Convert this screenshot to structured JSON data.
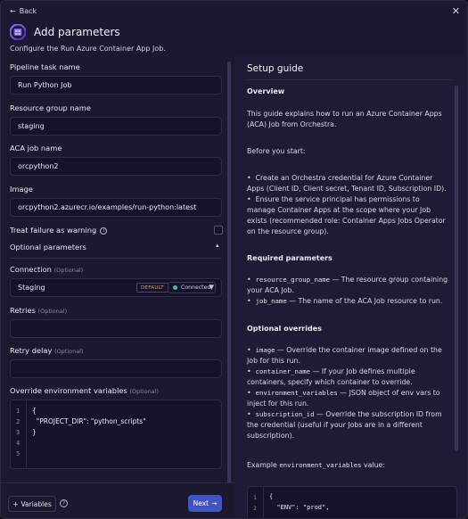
{
  "header": {
    "back_label": "Back",
    "close_glyph": "✕",
    "title": "Add parameters",
    "subtitle": "Configure the Run Azure Container App Job."
  },
  "form": {
    "pipeline_task_name": {
      "label": "Pipeline task name",
      "value": "Run Python Job"
    },
    "resource_group_name": {
      "label": "Resource group name",
      "value": "staging"
    },
    "aca_job_name": {
      "label": "ACA job name",
      "value": "orcpython2"
    },
    "image": {
      "label": "Image",
      "value": "orcpython2.azurecr.io/examples/run-python:latest"
    },
    "treat_failure": {
      "label": "Treat failure as warning",
      "checked": false
    },
    "optional_section": {
      "label": "Optional parameters",
      "expanded": true
    },
    "connection": {
      "label": "Connection",
      "optional_tag": "(Optional)",
      "value": "Staging",
      "default_badge": "DEFAULT",
      "status": "Connected"
    },
    "retries": {
      "label": "Retries",
      "optional_tag": "(Optional)",
      "value": ""
    },
    "retry_delay": {
      "label": "Retry delay",
      "optional_tag": "(Optional)",
      "value": ""
    },
    "override_env": {
      "label": "Override environment variables",
      "optional_tag": "(Optional)",
      "line_numbers": [
        "1",
        "2",
        "3",
        "4",
        "5"
      ],
      "lines": [
        "{",
        "  \"PROJECT_DIR\": \"python_scripts\"",
        "}",
        "",
        ""
      ]
    }
  },
  "footer": {
    "variables_label": "Variables",
    "help_glyph": "?",
    "next_label": "Next"
  },
  "guide": {
    "title": "Setup guide",
    "overview_heading": "Overview",
    "overview_text": "This guide explains how to run an Azure Container Apps (ACA) Job from Orchestra.",
    "before_heading": "Before you start:",
    "before_items": [
      "Create an Orchestra credential for Azure Container Apps (Client ID, Client secret, Tenant ID, Subscription ID).",
      "Ensure the service principal has permissions to manage Container Apps at the scope where your Job exists (recommended role: Container Apps Jobs Operator on the resource group)."
    ],
    "required_heading": "Required parameters",
    "required_items": [
      {
        "code": "resource_group_name",
        "text": " — The resource group containing your ACA Job."
      },
      {
        "code": "job_name",
        "text": " — The name of the ACA Job resource to run."
      }
    ],
    "optional_heading": "Optional overrides",
    "optional_items": [
      {
        "code": "image",
        "text": " — Override the container image defined on the Job for this run."
      },
      {
        "code": "container_name",
        "text": " — If your Job defines multiple containers, specify which container to override."
      },
      {
        "code": "environment_variables",
        "text": " — JSON object of env vars to inject for this run."
      },
      {
        "code": "subscription_id",
        "text": " — Override the subscription ID from the credential (useful if your Jobs are in a different subscription)."
      }
    ],
    "example_prefix": "Example ",
    "example_code": "environment_variables",
    "example_suffix": " value:",
    "example_line_numbers": [
      "1",
      "2"
    ],
    "example_lines": [
      "{",
      "  \"ENV\": \"prod\","
    ]
  },
  "colors": {
    "accent": "#3f55c7",
    "connected": "#3bc48a",
    "background": "#1b1830",
    "panel": "#1f1b36"
  },
  "icons": {
    "back": "arrow-left-icon",
    "close": "close-icon",
    "logo": "azure-container-apps-logo",
    "info": "info-icon",
    "chevron": "chevron-up-icon",
    "caret": "caret-down-icon",
    "plus": "plus-icon",
    "help": "help-icon",
    "next": "arrow-right-icon"
  }
}
